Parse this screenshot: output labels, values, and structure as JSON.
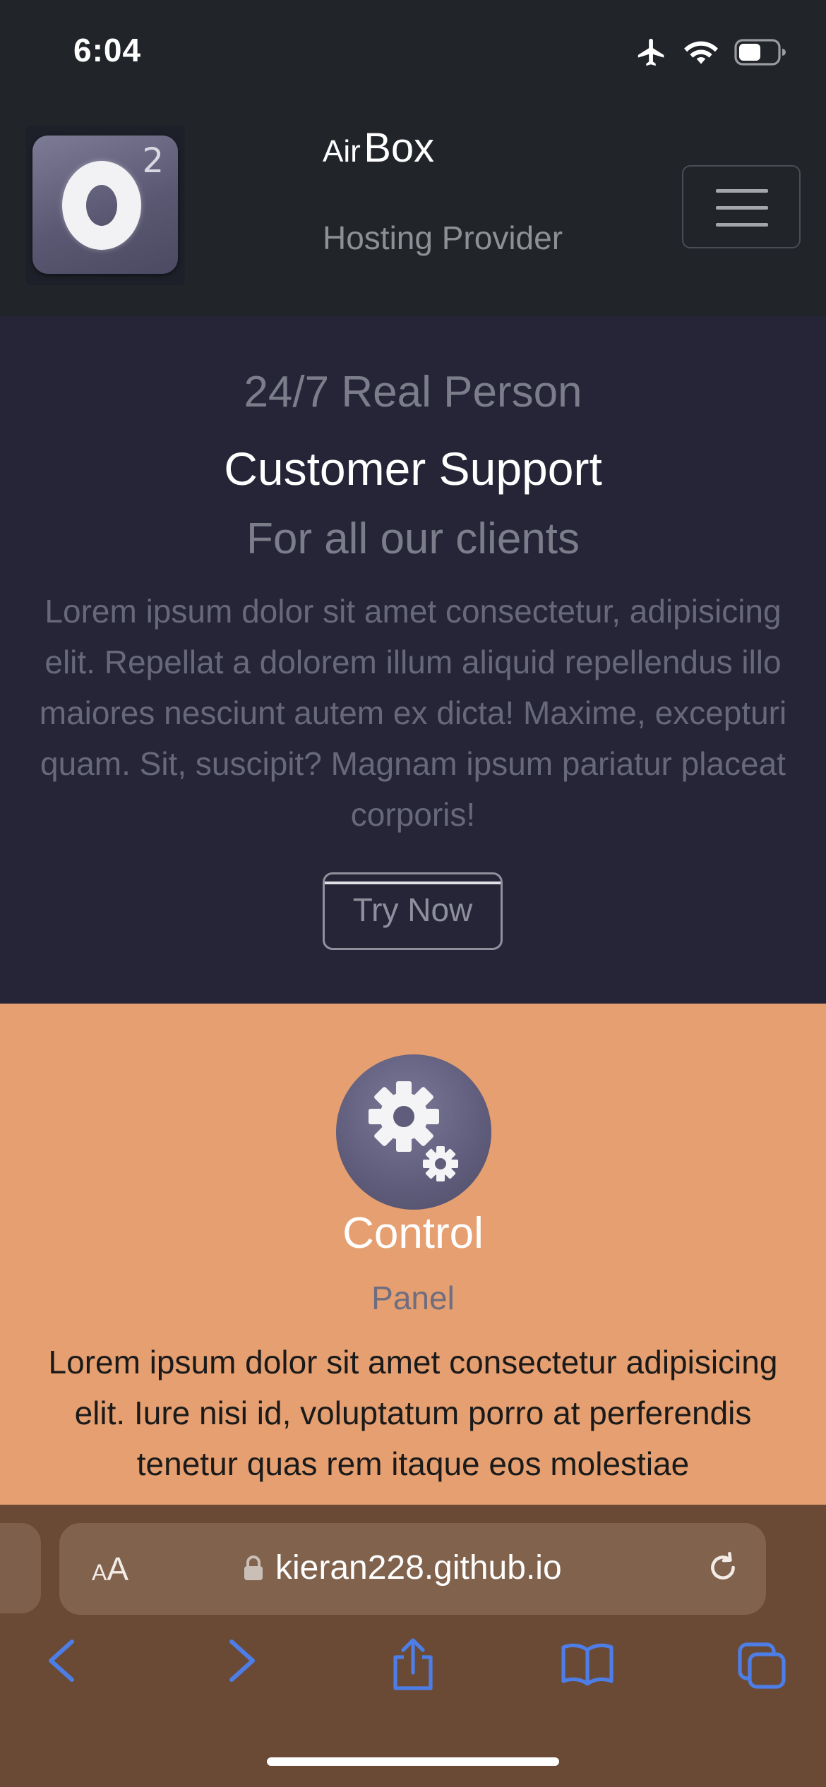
{
  "status_bar": {
    "time": "6:04"
  },
  "navbar": {
    "brand_small": "Air",
    "brand_big": "Box",
    "tagline": "Hosting Provider",
    "logo_letter": "O",
    "logo_superscript": "2"
  },
  "hero": {
    "line1": "24/7 Real Person",
    "line2": "Customer Support",
    "line3": "For all our clients",
    "text": "Lorem ipsum dolor sit amet consectetur, adipisicing elit. Repellat a dolorem illum aliquid repellendus illo maiores nesciunt autem ex dicta! Maxime, excepturi quam. Sit, suscipit? Magnam ipsum pariatur placeat corporis!",
    "button_label": "Try Now"
  },
  "feature": {
    "icon": "gears-icon",
    "title": "Control",
    "subtitle": "Panel",
    "text": "Lorem ipsum dolor sit amet consectetur adipisicing elit. Iure nisi id, voluptatum porro at perferendis tenetur quas rem itaque eos molestiae"
  },
  "safari": {
    "aa_small": "A",
    "aa_big": "A",
    "url": "kieran228.github.io"
  },
  "colors": {
    "navbar_bg": "#212429",
    "hero_bg": "#262538",
    "feature_bg": "#e69f70",
    "safari_bg": "#6a4a34",
    "toolbar_accent": "#4d7ee8"
  }
}
